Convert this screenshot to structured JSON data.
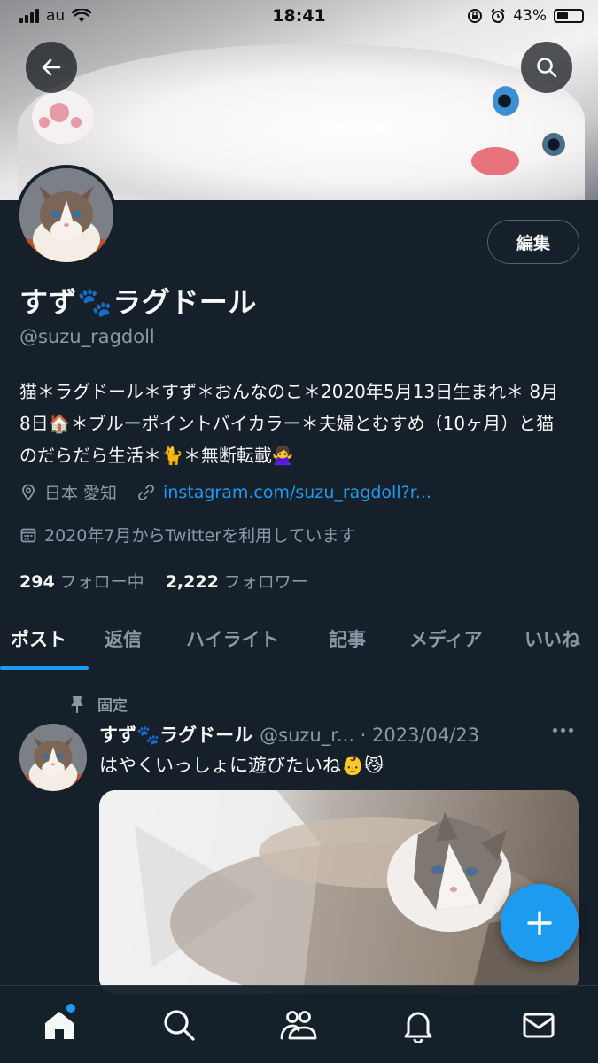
{
  "status_bar": {
    "carrier": "au",
    "time": "18:41",
    "battery": "43%"
  },
  "profile": {
    "display_name": "すず🐾ラグドール",
    "handle": "@suzu_ragdoll",
    "edit_label": "編集",
    "bio": "猫＊ラグドール＊すず＊おんなのこ＊2020年5月13日生まれ＊ 8月8日🏠＊ブルーポイントバイカラー＊夫婦とむすめ（10ヶ月）と猫のだらだら生活＊🐈＊無断転載🙅‍♀️",
    "location": "日本 愛知",
    "link": "instagram.com/suzu_ragdoll?r...",
    "joined": "2020年7月からTwitterを利用しています",
    "following_count": "294",
    "following_label": "フォロー中",
    "followers_count": "2,222",
    "followers_label": "フォロワー"
  },
  "tabs": [
    "ポスト",
    "返信",
    "ハイライト",
    "記事",
    "メディア",
    "いいね"
  ],
  "active_tab": "ポスト",
  "post": {
    "pinned_label": "固定",
    "name": "すず🐾ラグドール",
    "meta": "@suzu_r... · 2023/04/23",
    "text": "はやくいっしょに遊びたいね👶😼"
  },
  "icons": {
    "back": "arrow-left-icon",
    "search": "search-icon",
    "location": "location-pin-icon",
    "link": "link-icon",
    "calendar": "calendar-icon",
    "pin": "pin-icon",
    "more": "more-icon",
    "compose": "plus-icon",
    "nav": [
      "home-icon",
      "search-icon",
      "communities-icon",
      "bell-icon",
      "mail-icon"
    ]
  },
  "colors": {
    "background": "#15202b",
    "accent": "#1d9bf0",
    "muted": "#8b98a5"
  }
}
